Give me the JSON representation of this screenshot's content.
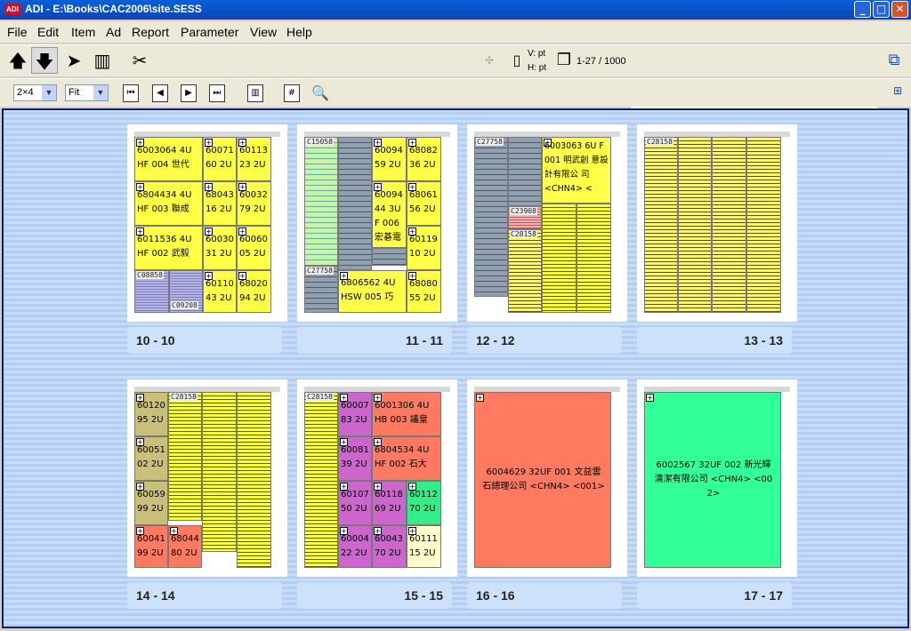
{
  "window": {
    "title": "ADI - E:\\Books\\CAC2006\\site.SESS",
    "icon_text": "ADI"
  },
  "menu": [
    "File",
    "Edit",
    "Item",
    "Ad",
    "Report",
    "Parameter",
    "View",
    "Help"
  ],
  "toolbar": {
    "v_label": "V: pt",
    "h_label": "H: pt",
    "page_count": "1-27 / 1000",
    "message": ""
  },
  "toolbar2": {
    "layout_value": "2×4",
    "zoom_value": "Fit"
  },
  "cards": [
    {
      "left": "10 - 10",
      "right": "",
      "blocks": [
        "6003064 4U HF 004 世代",
        "60071 60 2U",
        "60113 23 2U",
        "6804434 4U HF 003 聯成",
        "68043 16 2U",
        "60032 79 2U",
        "6011536 4U HF 002 武毅",
        "60030 31 2U",
        "60060 05 2U",
        "C08858",
        "C09208",
        "60110 43 2U",
        "68020 94 2U"
      ]
    },
    {
      "left": "",
      "right": "11 - 11",
      "blocks": [
        "C15058",
        "60094 59 2U",
        "68082 36 2U",
        "60094 44 3U F 006 宏碁電",
        "68061 56 2U",
        "60119 10 2U",
        "C27758",
        "6806562 4U HSW 005 巧",
        "68080 55 2U"
      ]
    },
    {
      "left": "12 - 12",
      "right": "",
      "blocks": [
        "C27758",
        "6003063 6U F 001 明武創 意設計有限公 司 <CHN4> <",
        "C23908",
        "C28158"
      ]
    },
    {
      "left": "",
      "right": "13 - 13",
      "blocks": [
        "C28158"
      ]
    },
    {
      "left": "14 - 14",
      "right": "",
      "blocks": [
        "60120 95 2U",
        "C28158",
        "60051 02 2U",
        "60059 99 2U",
        "60041 99 2U",
        "68044 80 2U"
      ]
    },
    {
      "left": "",
      "right": "15 - 15",
      "blocks": [
        "C28158",
        "60007 83 2U",
        "6001306 4U HB 003 議皇",
        "60081 39 2U",
        "6804534 4U HF 002 石大",
        "60107 50 2U",
        "60118 69 2U",
        "60112 70 2U",
        "60004 22 2U",
        "60043 70 2U",
        "60111 15 2U"
      ]
    },
    {
      "left": "16 - 16",
      "right": "",
      "blocks": [
        "6004629 32UF 001 文益雲 石總理公司 <CHN4> <001>"
      ]
    },
    {
      "left": "",
      "right": "17 - 17",
      "blocks": [
        "6002567 32UF 002 新光輝 清潔有限公司 <CHN4> <00 2>"
      ]
    }
  ],
  "colors": {
    "yellow": "#ffff48",
    "salmon": "#ff7a60",
    "green": "#33ff99",
    "purple": "#cc66cc",
    "olive": "#c8c078",
    "cyan": "#33ee88",
    "cream": "#ffffcc"
  }
}
